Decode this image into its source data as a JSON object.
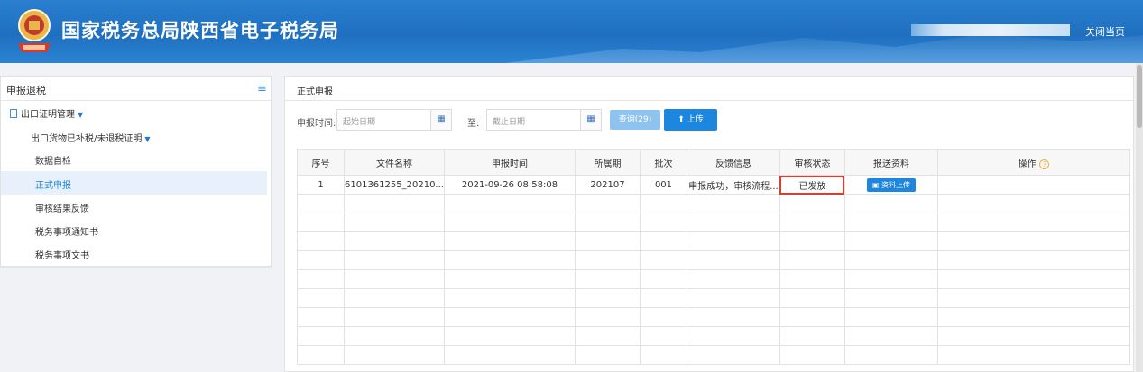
{
  "header": {
    "title": "国家税务总局陕西省电子税务局",
    "close_label": "关闭当页",
    "logo_icon": "tax-emblem"
  },
  "sidebar": {
    "title": "申报退税",
    "menu_icon": "menu-icon",
    "group": {
      "label": "出口证明管理"
    },
    "subgroup": {
      "label": "出口货物已补税/未退税证明"
    },
    "items": [
      {
        "label": "数据自检"
      },
      {
        "label": "正式申报"
      },
      {
        "label": "审核结果反馈"
      },
      {
        "label": "税务事项通知书"
      },
      {
        "label": "税务事项文书"
      }
    ],
    "active_index": 1
  },
  "main": {
    "tab_title": "正式申报",
    "search": {
      "report_time_label": "申报时间:",
      "start_placeholder": "起始日期",
      "to_label": "至:",
      "end_placeholder": "截止日期",
      "query_label": "查询(29)",
      "upload_label": "上传"
    },
    "table": {
      "headers": [
        "序号",
        "文件名称",
        "申报时间",
        "所属期",
        "批次",
        "反馈信息",
        "审核状态",
        "报送资料",
        "操作"
      ],
      "rows": [
        {
          "index": "1",
          "file_name": "6101361255_20210...",
          "report_time": "2021-09-26 08:58:08",
          "period": "202107",
          "batch": "001",
          "feedback": "申报成功，审核流程...",
          "status": "已发放",
          "attach_label": "资料上传"
        }
      ]
    }
  },
  "colors": {
    "header_blue": "#1f6fc0",
    "primary_button": "#1d86de",
    "highlight_red": "#e23b2e"
  }
}
